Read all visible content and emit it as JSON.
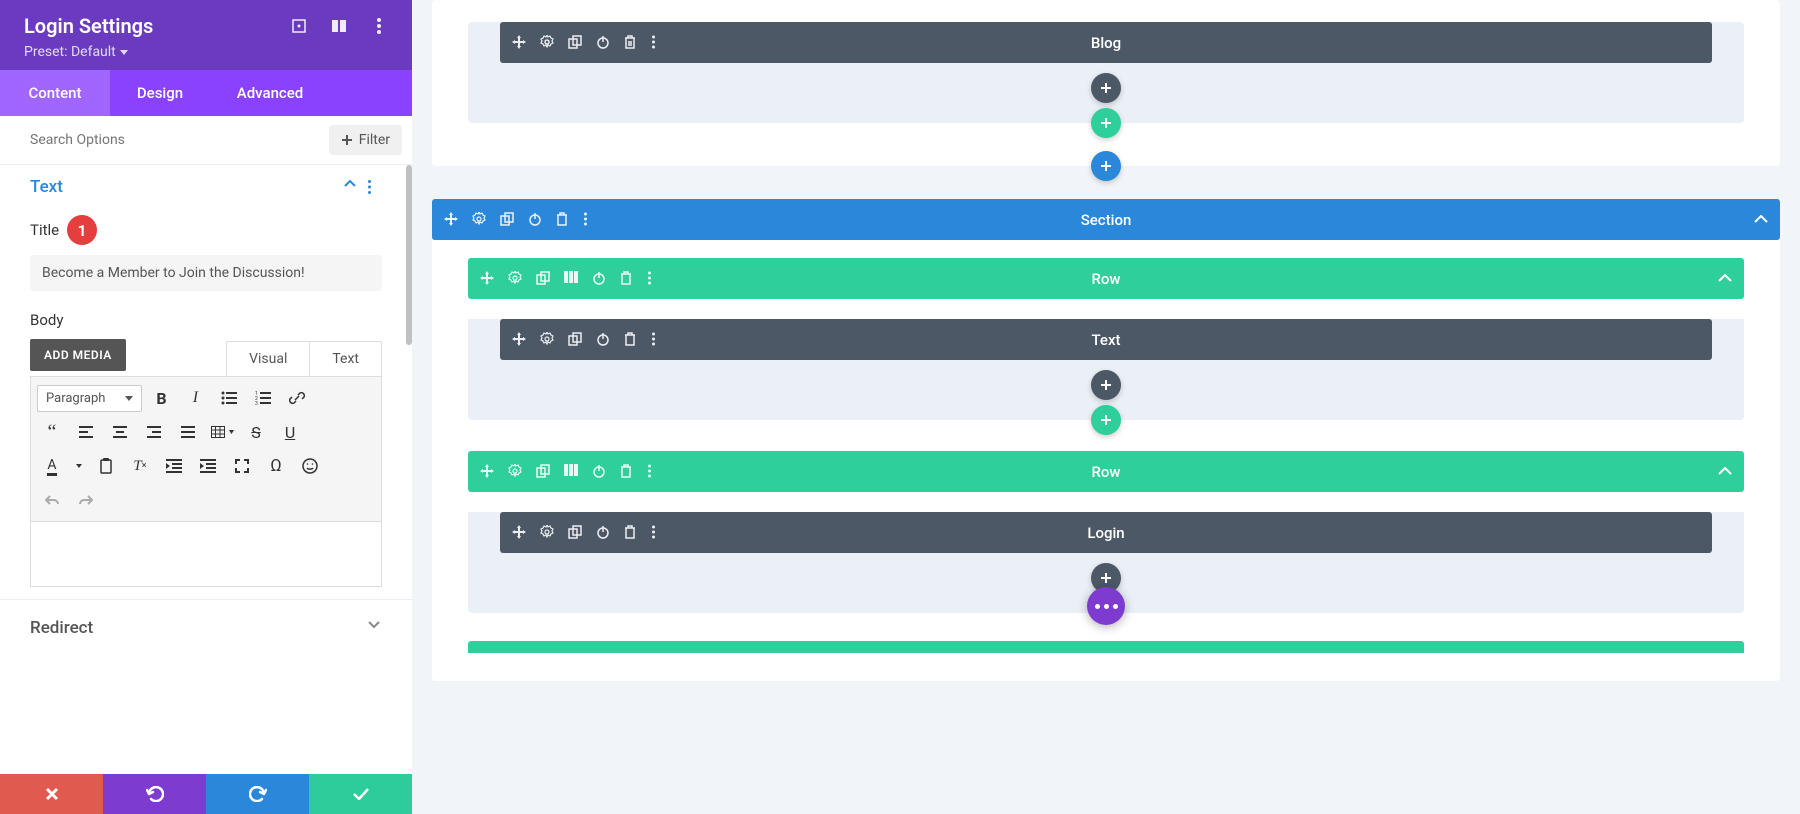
{
  "sidebar": {
    "title": "Login Settings",
    "preset_label": "Preset: Default",
    "tabs": [
      "Content",
      "Design",
      "Advanced"
    ],
    "active_tab": 0,
    "search_placeholder": "Search Options",
    "filter_label": "Filter",
    "text_section": {
      "title": "Text",
      "badge": "1",
      "title_label": "Title",
      "title_value": "Become a Member to Join the Discussion!",
      "body_label": "Body",
      "add_media_label": "ADD MEDIA",
      "editor_tabs": [
        "Visual",
        "Text"
      ],
      "format_label": "Paragraph"
    },
    "redirect_section": {
      "title": "Redirect"
    },
    "toolbar_icons": {
      "row1": [
        "bold-icon",
        "italic-icon",
        "bullet-list-icon",
        "numbered-list-icon",
        "link-icon"
      ],
      "row2": [
        "quote-icon",
        "align-left-icon",
        "align-center-icon",
        "align-right-icon",
        "align-justify-icon",
        "table-icon",
        "strikethrough-icon",
        "underline-icon"
      ],
      "row3": [
        "text-color-icon",
        "paste-icon",
        "clear-format-icon",
        "outdent-icon",
        "indent-icon",
        "fullscreen-icon",
        "special-char-icon",
        "emoji-icon"
      ],
      "row4": [
        "undo-icon",
        "redo-icon"
      ]
    }
  },
  "canvas": {
    "modules": {
      "blog": "Blog",
      "section": "Section",
      "row": "Row",
      "text": "Text",
      "login": "Login"
    }
  },
  "colors": {
    "purple_dark": "#6b3bbf",
    "purple": "#8a42ff",
    "purple_light": "#a166ff",
    "blue": "#2b87da",
    "green": "#2fcf9b",
    "dark": "#4c5866",
    "red": "#e05a4f"
  }
}
